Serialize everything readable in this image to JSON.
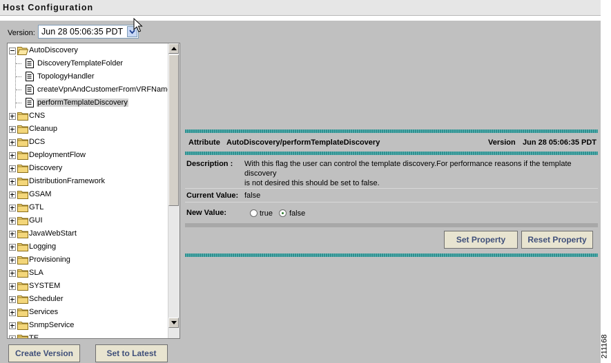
{
  "window": {
    "title": "Host Configuration"
  },
  "version": {
    "label": "Version:",
    "selected": "Jun 28 05:06:35 PDT"
  },
  "tree": {
    "root": {
      "label": "AutoDiscovery",
      "children": [
        "DiscoveryTemplateFolder",
        "TopologyHandler",
        "createVpnAndCustomerFromVRFName",
        "performTemplateDiscovery"
      ],
      "selected": "performTemplateDiscovery"
    },
    "folders": [
      "CNS",
      "Cleanup",
      "DCS",
      "DeploymentFlow",
      "Discovery",
      "DistributionFramework",
      "GSAM",
      "GTL",
      "GUI",
      "JavaWebStart",
      "Logging",
      "Provisioning",
      "SLA",
      "SYSTEM",
      "Scheduler",
      "Services",
      "SnmpService",
      "TE"
    ]
  },
  "buttons": {
    "create_version": "Create Version",
    "set_to_latest": "Set to Latest",
    "set_property": "Set Property",
    "reset_property": "Reset Property"
  },
  "attribute": {
    "label": "Attribute",
    "path": "AutoDiscovery/performTemplateDiscovery",
    "version_label": "Version",
    "version_value": "Jun 28 05:06:35 PDT"
  },
  "properties": {
    "description_label": "Description :",
    "description_lines": [
      "With this flag the user can control the template discovery.For performance reasons if the template",
      "discovery",
      "is not desired this should be set to false."
    ],
    "current_label": "Current Value:",
    "current_value": "false",
    "new_label": "New Value:",
    "options": [
      "true",
      "false"
    ],
    "selected_option": "false"
  },
  "figure_number": "211168"
}
